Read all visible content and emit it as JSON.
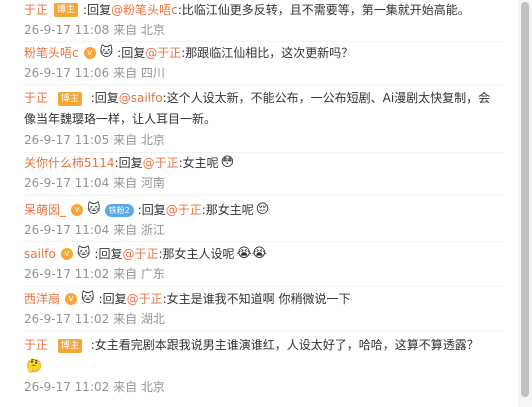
{
  "comments": [
    {
      "name": "于正",
      "badge": "博主",
      "reply_prefix": ":回复",
      "mention": "@粉笔头唔c",
      "text": ":比临江仙更多反转，且不需要等，第一集就开始高能。",
      "date": "26-9-17 11:08",
      "from": "来自",
      "loc": "北京"
    },
    {
      "name": "粉笔头唔c",
      "vbadge": "v",
      "avatar": "🐱",
      "reply_prefix": ":回复",
      "mention": "@于正",
      "text": ":那跟临江仙相比，这次更新吗？",
      "date": "26-9-17 11:06",
      "from": "来自",
      "loc": "四川"
    },
    {
      "name": "于正",
      "badge": "博主",
      "reply_prefix": ":回复",
      "mention": "@sailfo",
      "text": ":这个人设太新，不能公布，一公布短剧、Ai漫剧太快复制，会像当年魏璎珞一样，让人耳目一新。",
      "date": "26-9-17 11:05",
      "from": "来自",
      "loc": "北京"
    },
    {
      "name": "关你什么柿5114",
      "reply_prefix": ":回复",
      "mention": "@于正",
      "text": ":女主呢",
      "emoji": "😳",
      "date": "26-9-17 11:04",
      "from": "来自",
      "loc": "河南"
    },
    {
      "name": "呆萌囡_",
      "vbadge": "v",
      "avatar": "🐱",
      "fan_badge": "铁粉2",
      "reply_prefix": ":回复",
      "mention": "@于正",
      "text": ":那女主呢",
      "emoji": "😔",
      "date": "26-9-17 11:04",
      "from": "来自",
      "loc": "浙江"
    },
    {
      "name": "sailfo",
      "vbadge": "v",
      "avatar": "🐱",
      "reply_prefix": ":回复",
      "mention": "@于正",
      "text": ":那女主人设呢",
      "emoji": "😭😭",
      "date": "26-9-17 11:02",
      "from": "来自",
      "loc": "广东"
    },
    {
      "name": "西洋扇",
      "vbadge": "v",
      "avatar": "🐱",
      "reply_prefix": ":回复",
      "mention": "@于正",
      "text": ":女主是谁我不知道啊 你稍微说一下",
      "date": "26-9-17 11:02",
      "from": "来自",
      "loc": "湖北"
    },
    {
      "name": "于正",
      "badge": "博主",
      "text": ":女主看完剧本跟我说男主谁演谁红，人设太好了，哈哈，这算不算透露？",
      "emoji": "🤔",
      "date": "26-9-17 11:02",
      "from": "来自",
      "loc": "北京"
    }
  ]
}
